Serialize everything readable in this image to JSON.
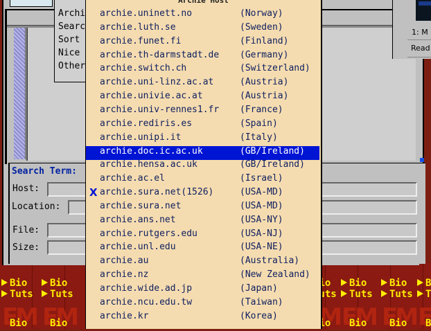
{
  "dropdown": {
    "title": "Archie Host",
    "hosts": [
      {
        "host": "archie.uninett.no",
        "country": "(Norway)"
      },
      {
        "host": "archie.luth.se",
        "country": "(Sweden)"
      },
      {
        "host": "archie.funet.fi",
        "country": "(Finland)"
      },
      {
        "host": "archie.th-darmstadt.de",
        "country": "(Germany)"
      },
      {
        "host": "archie.switch.ch",
        "country": "(Switzerland)"
      },
      {
        "host": "archie.uni-linz.ac.at",
        "country": "(Austria)"
      },
      {
        "host": "archie.univie.ac.at",
        "country": "(Austria)"
      },
      {
        "host": "archie.univ-rennes1.fr",
        "country": "(France)"
      },
      {
        "host": "archie.rediris.es",
        "country": "(Spain)"
      },
      {
        "host": "archie.unipi.it",
        "country": "(Italy)"
      },
      {
        "host": "archie.doc.ic.ac.uk",
        "country": "(GB/Ireland)"
      },
      {
        "host": "archie.hensa.ac.uk",
        "country": "(GB/Ireland)"
      },
      {
        "host": "archie.ac.el",
        "country": "(Israel)"
      },
      {
        "host": "archie.sura.net(1526)",
        "country": "(USA-MD)"
      },
      {
        "host": "archie.sura.net",
        "country": "(USA-MD)"
      },
      {
        "host": "archie.ans.net",
        "country": "(USA-NY)"
      },
      {
        "host": "archie.rutgers.edu",
        "country": "(USA-NJ)"
      },
      {
        "host": "archie.unl.edu",
        "country": "(USA-NE)"
      },
      {
        "host": "archie.au",
        "country": "(Australia)"
      },
      {
        "host": "archie.nz",
        "country": "(New Zealand)"
      },
      {
        "host": "archie.wide.ad.jp",
        "country": "(Japan)"
      },
      {
        "host": "archie.ncu.edu.tw",
        "country": "(Taiwan)"
      },
      {
        "host": "archie.kr",
        "country": "(Korea)"
      }
    ],
    "selected_host": "archie.doc.ic.ac.uk",
    "marked_host": "archie.sura.net(1526)",
    "mark_glyph": "X",
    "selection_color": "#0014d4"
  },
  "options_menu": {
    "items": [
      "Archi",
      "Searc",
      "Sort",
      "Nice",
      "Other"
    ]
  },
  "search_panel": {
    "title": "Search Term:",
    "host_label": "Host:",
    "location_label": "Location:",
    "file_label": "File:",
    "size_label": "Size:"
  },
  "right_window": {
    "line1": "1: M",
    "line2": "Read"
  },
  "banner": {
    "word1": "Bio",
    "word2": "Tuts",
    "logo_icon": "em-logo-icon"
  }
}
